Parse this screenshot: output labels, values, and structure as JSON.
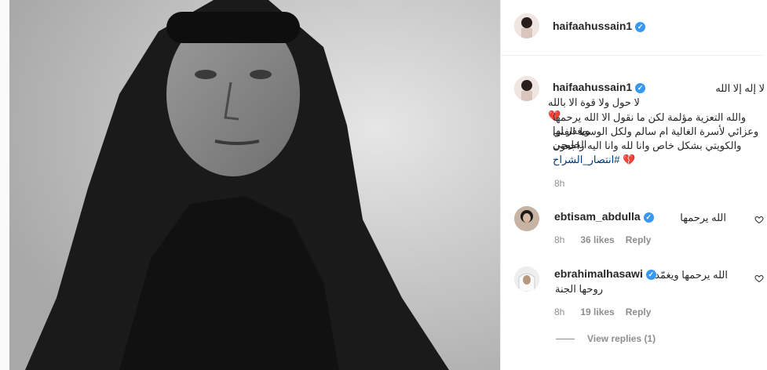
{
  "post": {
    "author": "haifaahussain1",
    "caption_lines": [
      "لا إله إلا الله",
      "لا حول ولا قوة الا بالله 💔",
      "والله التعزية مؤلمة لكن ما نقول الا الله يرحمها ويغفر لها",
      "وعزائي لأسرة الغالية ام سالم ولكل الوسط الفني الخليجي",
      "والكويتي بشكل خاص وانا لله وانا اليه راجعون"
    ],
    "hashtag": "#انتصار_الشراح",
    "hashtag_suffix": "💔",
    "time": "8h"
  },
  "comments": [
    {
      "user": "ebtisam_abdulla",
      "text": "الله يرحمها",
      "time": "8h",
      "likes": "36 likes",
      "reply": "Reply"
    },
    {
      "user": "ebrahimalhasawi",
      "text": "الله يرحمها ويغمّد",
      "text2": "روحها الجنة",
      "time": "8h",
      "likes": "19 likes",
      "reply": "Reply",
      "view_replies": "View replies (1)"
    }
  ],
  "colors": {
    "verified": "#3897f0",
    "hashtag": "#00376b",
    "muted": "#8e8e8e",
    "heart": "#ed4956"
  }
}
